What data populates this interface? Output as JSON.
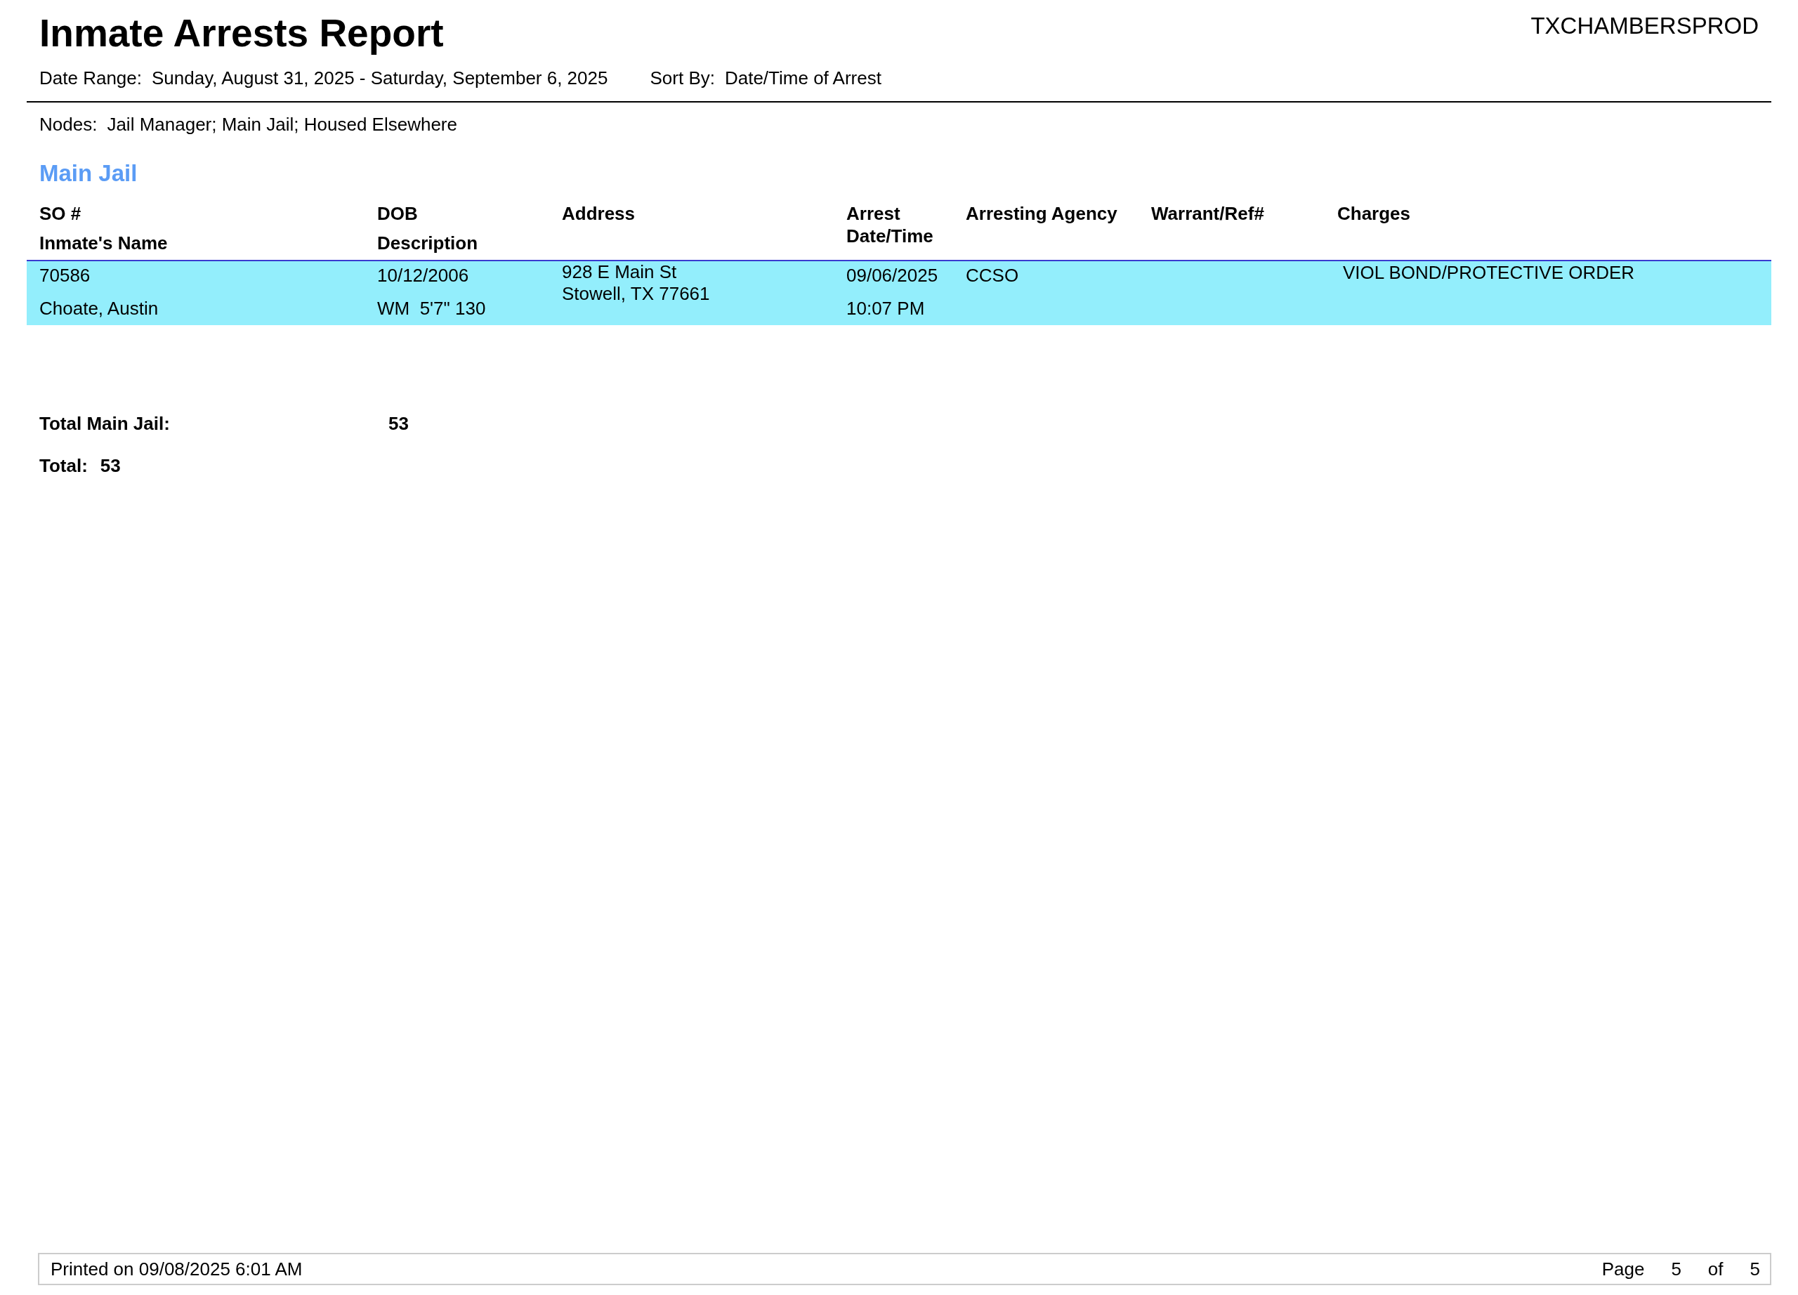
{
  "report": {
    "title": "Inmate Arrests Report",
    "system": "TXCHAMBERSPROD",
    "date_range_label": "Date Range:",
    "date_range": "Sunday, August 31, 2025 - Saturday, September 6, 2025",
    "sort_by_label": "Sort By:",
    "sort_by": "Date/Time of Arrest",
    "nodes_label": "Nodes:",
    "nodes": "Jail Manager; Main Jail; Housed Elsewhere"
  },
  "section": {
    "title": "Main Jail",
    "columns": [
      {
        "top": "SO #",
        "bottom": "Inmate's Name"
      },
      {
        "top": "DOB",
        "bottom": "Description"
      },
      {
        "top": "Address"
      },
      {
        "top": "Arrest Date/Time"
      },
      {
        "top": "Arresting Agency"
      },
      {
        "top": "Warrant/Ref#"
      },
      {
        "top": "Charges"
      }
    ],
    "rows": [
      {
        "so": "70586",
        "name": "Choate, Austin",
        "dob": "10/12/2006",
        "description": "WM  5'7\" 130",
        "address": [
          "928 E Main St",
          "Stowell, TX 77661"
        ],
        "arrest_date": "09/06/2025",
        "arrest_time": "10:07 PM",
        "agency": "CCSO",
        "charges": "VIOL BOND/PROTECTIVE ORDER"
      }
    ],
    "total_label": "Total Main Jail:",
    "total_value": "53"
  },
  "grand_total": {
    "label": "Total:",
    "value": "53"
  },
  "footer": {
    "printed": "Printed on 09/08/2025 6:01 AM",
    "page_label": "Page",
    "page": "5",
    "of_label": "of",
    "pages": "5"
  }
}
